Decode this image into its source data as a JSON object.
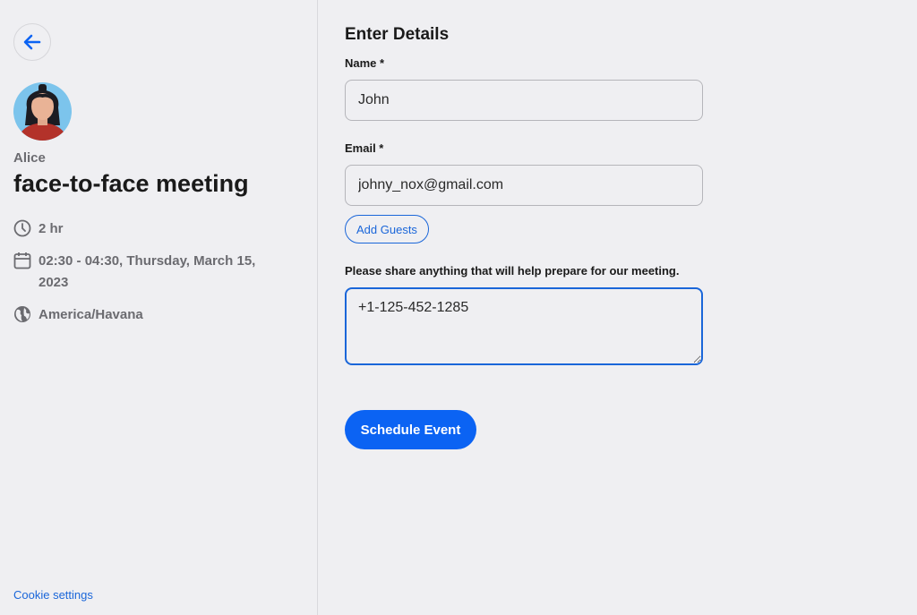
{
  "header": {
    "host_name": "Alice",
    "event_title": "face-to-face meeting"
  },
  "details": {
    "duration": "2 hr",
    "datetime": "02:30 - 04:30, Thursday, March 15, 2023",
    "timezone": "America/Havana",
    "icons": [
      "clock-icon",
      "calendar-icon",
      "globe-icon"
    ]
  },
  "footer": {
    "cookie_link": "Cookie settings"
  },
  "form": {
    "title": "Enter Details",
    "name_label": "Name *",
    "name_value": "John",
    "email_label": "Email *",
    "email_value": "johny_nox@gmail.com",
    "add_guests_label": "Add Guests",
    "notes_label": "Please share anything that will help prepare for our meeting.",
    "notes_value": "+1-125-452-1285",
    "submit_label": "Schedule Event"
  },
  "colors": {
    "accent": "#0b63f3",
    "link": "#1a66d9",
    "background": "#efeff2",
    "muted_text": "#6b6b70"
  }
}
